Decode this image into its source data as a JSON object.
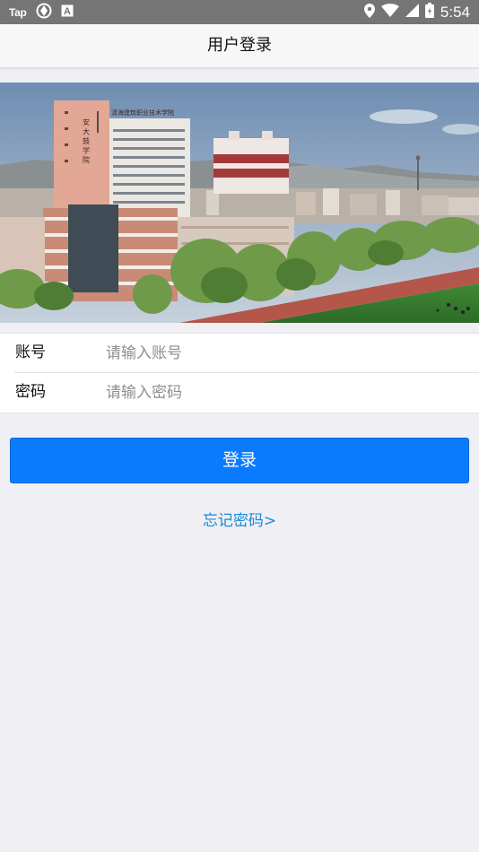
{
  "status_bar": {
    "app_label": "Tap",
    "time": "5:54",
    "icons": [
      "tap-app-icon",
      "sync-icon",
      "a-notification-icon",
      "location-icon",
      "wifi-icon",
      "signal-icon",
      "battery-icon"
    ]
  },
  "nav": {
    "title": "用户登录"
  },
  "banner": {
    "sign_vertical": "安 大 鼓 学 院",
    "sign_horizontal": "清海建筑职业技术学院"
  },
  "form": {
    "account": {
      "label": "账号",
      "placeholder": "请输入账号",
      "value": ""
    },
    "password": {
      "label": "密码",
      "placeholder": "请输入密码",
      "value": ""
    }
  },
  "actions": {
    "login_label": "登录",
    "forgot_label": "忘记密码>"
  },
  "colors": {
    "primary": "#0a7bff",
    "link": "#1a8ad8",
    "background": "#efeff4",
    "status_bar": "#757575"
  }
}
